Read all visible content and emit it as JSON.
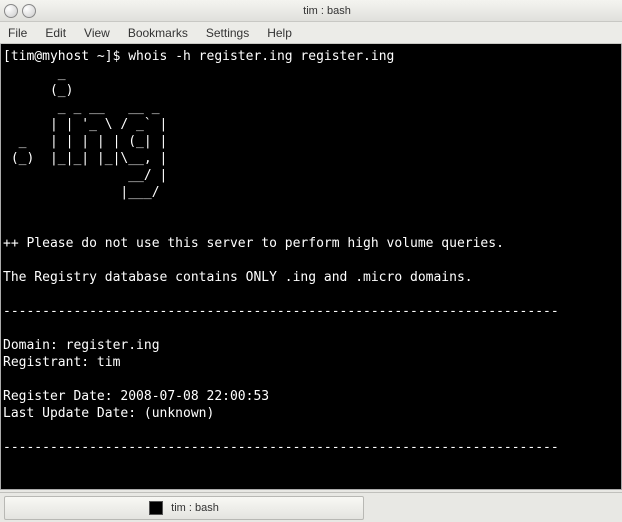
{
  "window": {
    "title": "tim : bash"
  },
  "menubar": {
    "items": [
      "File",
      "Edit",
      "View",
      "Bookmarks",
      "Settings",
      "Help"
    ]
  },
  "terminal": {
    "prompt": "[tim@myhost ~]$",
    "command": "whois -h register.ing register.ing",
    "ascii_art": [
      "       _",
      "      (_)",
      "       _ _ __   __ _",
      "      | | '_ \\ / _` |",
      "  _   | | | | | (_| |",
      " (_)  |_|_| |_|\\__, |",
      "                __/ |",
      "               |___/"
    ],
    "notice1": "++ Please do not use this server to perform high volume queries.",
    "notice2": "The Registry database contains ONLY .ing and .micro domains.",
    "divider": "-----------------------------------------------------------------------",
    "domain_line": "Domain: register.ing",
    "registrant_line": "Registrant: tim",
    "register_date_line": "Register Date: 2008-07-08 22:00:53",
    "last_update_line": "Last Update Date: (unknown)"
  },
  "taskbar": {
    "item_label": "tim : bash"
  }
}
